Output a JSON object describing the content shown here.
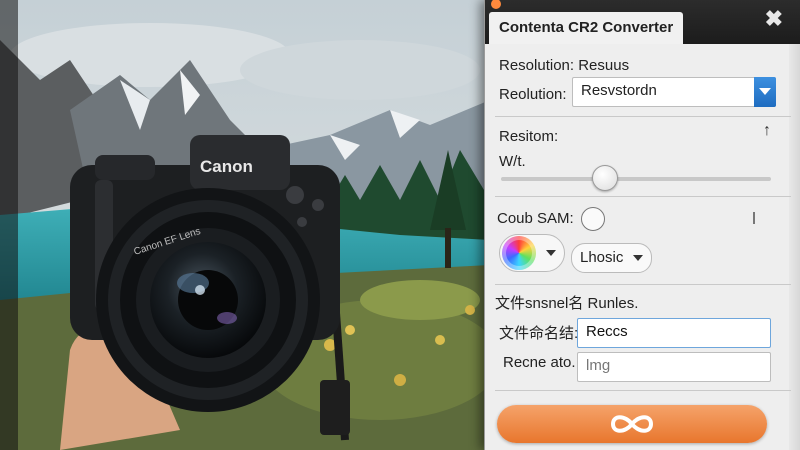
{
  "window": {
    "title": "Contenta CR2 Converter",
    "close_glyph": "✖",
    "traffic_lights": [
      "#ff8a3d",
      "#c8c8c8",
      "#c8c8c8"
    ]
  },
  "photo": {
    "camera_brand": "Canon",
    "lens_text": "Canon EF Lens"
  },
  "resolution": {
    "header": "Resolution: Resuus",
    "label": "Reolution:",
    "value": "Resvstordn"
  },
  "resize": {
    "header": "Resitom:",
    "sub_label": "W/t.",
    "slider_value": 0.38
  },
  "color": {
    "label": "Coub SAM:",
    "mode_value": "Lhosic"
  },
  "rename": {
    "header": "文件snsnel名 Runles.",
    "name_label": "文件命名结:",
    "name_value": "Reccs",
    "ext_label": "Recne ato.",
    "ext_placeholder": "lmg"
  },
  "convert_button": {
    "label": "∞",
    "color": "#ee7f38"
  }
}
